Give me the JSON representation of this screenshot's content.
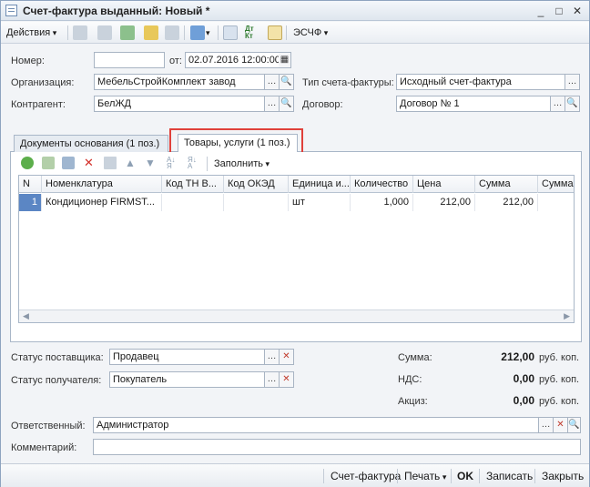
{
  "window": {
    "title": "Счет-фактура выданный: Новый *",
    "controls": {
      "minimize": "_",
      "maximize": "□",
      "close": "✕"
    }
  },
  "toolbar": {
    "actions_label": "Действия",
    "eschf_label": "ЭСЧФ",
    "dt_kt_label": "Дт Кт"
  },
  "form": {
    "number_label": "Номер:",
    "number_value": "",
    "date_label": "от:",
    "date_value": "02.07.2016 12:00:00",
    "org_label": "Организация:",
    "org_value": "МебельСтройКомплект завод",
    "invoice_type_label": "Тип счета-фактуры:",
    "invoice_type_value": "Исходный счет-фактура",
    "counterparty_label": "Контрагент:",
    "counterparty_value": "БелЖД",
    "contract_label": "Договор:",
    "contract_value": "Договор № 1"
  },
  "tabs": [
    {
      "label": "Документы основания (1 поз.)"
    },
    {
      "label": "Товары, услуги (1 поз.)"
    }
  ],
  "goods": {
    "fill_label": "Заполнить",
    "columns": [
      "N",
      "Номенклатура",
      "Код ТН В...",
      "Код ОКЭД",
      "Единица и...",
      "Количество",
      "Цена",
      "Сумма",
      "Сумма"
    ],
    "rows": [
      {
        "n": "1",
        "name": "Кондиционер FIRMST...",
        "tn_code": "",
        "oked_code": "",
        "unit": "шт",
        "qty": "1,000",
        "price": "212,00",
        "sum": "212,00",
        "sum2": ""
      }
    ]
  },
  "status": {
    "supplier_label": "Статус поставщика:",
    "supplier_value": "Продавец",
    "recipient_label": "Статус получателя:",
    "recipient_value": "Покупатель"
  },
  "totals": {
    "sum_label": "Сумма:",
    "sum_value": "212,00",
    "vat_label": "НДС:",
    "vat_value": "0,00",
    "excise_label": "Акциз:",
    "excise_value": "0,00",
    "unit": "руб. коп."
  },
  "footer_fields": {
    "responsible_label": "Ответственный:",
    "responsible_value": "Администратор",
    "comment_label": "Комментарий:",
    "comment_value": ""
  },
  "bottom_bar": {
    "invoice": "Счет-фактура",
    "print": "Печать",
    "ok": "OK",
    "save": "Записать",
    "close": "Закрыть"
  },
  "colors": {
    "highlight": "#e0403a",
    "accent": "#6f8db3"
  }
}
